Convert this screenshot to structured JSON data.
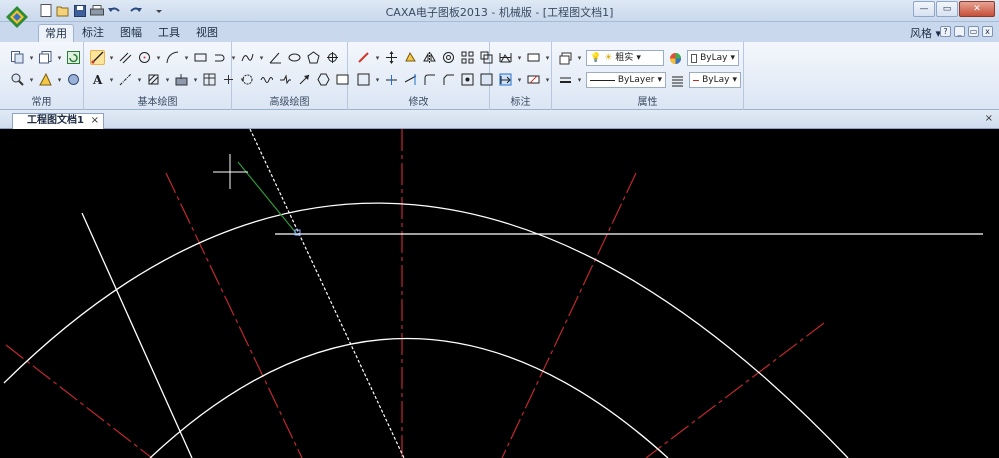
{
  "titlebar": {
    "title": "CAXA电子图板2013 - 机械版 - [工程图文档1]",
    "qat_icons": [
      "new-icon",
      "open-icon",
      "save-icon",
      "print-icon",
      "undo-icon",
      "redo-icon",
      "customize-icon"
    ]
  },
  "menu": {
    "tabs": [
      "常用",
      "标注",
      "图幅",
      "工具",
      "视图"
    ],
    "active_tab": "常用",
    "style_label": "风格"
  },
  "ribbon": {
    "groups": [
      {
        "label": "常用"
      },
      {
        "label": "基本绘图"
      },
      {
        "label": "高级绘图"
      },
      {
        "label": "修改"
      },
      {
        "label": "标注"
      },
      {
        "label": "属性"
      }
    ],
    "line_weight_value": "粗实",
    "layer_color_value": "ByLay",
    "linetype_value": "ByLayer",
    "line_color_value": "ByLay",
    "accent_color": "#fde49b"
  },
  "document": {
    "tab_label": "工程图文档1",
    "close_glyph": "×"
  },
  "canvas": {
    "background": "#000000",
    "line_color": "#ffffff",
    "centerline_color": "#c0282d",
    "highlight_color": "#2e9a3a"
  }
}
